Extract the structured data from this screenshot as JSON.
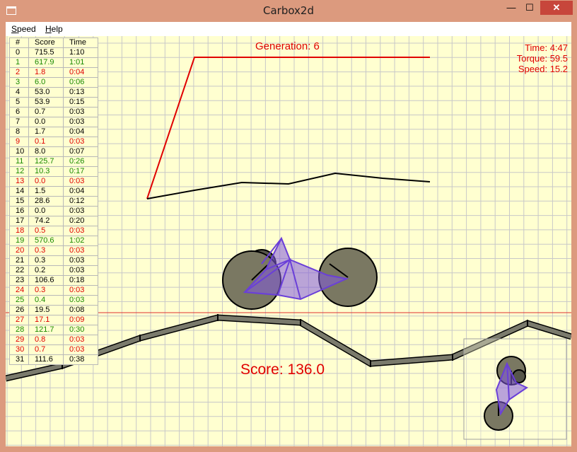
{
  "window": {
    "title": "Carbox2d",
    "minimize_glyph": "—",
    "maximize_glyph": "☐",
    "close_glyph": "✕"
  },
  "menu": {
    "speed": {
      "access": "S",
      "rest": "peed"
    },
    "help": {
      "access": "H",
      "rest": "elp"
    }
  },
  "table": {
    "headers": [
      "#",
      "Score",
      "Time"
    ],
    "rows": [
      {
        "n": "0",
        "score": "715.5",
        "time": "1:10",
        "status": "normal"
      },
      {
        "n": "1",
        "score": "617.9",
        "time": "1:01",
        "status": "best"
      },
      {
        "n": "2",
        "score": "1.8",
        "time": "0:04",
        "status": "worst"
      },
      {
        "n": "3",
        "score": "6.0",
        "time": "0:06",
        "status": "best"
      },
      {
        "n": "4",
        "score": "53.0",
        "time": "0:13",
        "status": "normal"
      },
      {
        "n": "5",
        "score": "53.9",
        "time": "0:15",
        "status": "normal"
      },
      {
        "n": "6",
        "score": "0.7",
        "time": "0:03",
        "status": "normal"
      },
      {
        "n": "7",
        "score": "0.0",
        "time": "0:03",
        "status": "normal"
      },
      {
        "n": "8",
        "score": "1.7",
        "time": "0:04",
        "status": "normal"
      },
      {
        "n": "9",
        "score": "0.1",
        "time": "0:03",
        "status": "worst"
      },
      {
        "n": "10",
        "score": "8.0",
        "time": "0:07",
        "status": "normal"
      },
      {
        "n": "11",
        "score": "125.7",
        "time": "0:26",
        "status": "best"
      },
      {
        "n": "12",
        "score": "10.3",
        "time": "0:17",
        "status": "best"
      },
      {
        "n": "13",
        "score": "0.0",
        "time": "0:03",
        "status": "worst"
      },
      {
        "n": "14",
        "score": "1.5",
        "time": "0:04",
        "status": "normal"
      },
      {
        "n": "15",
        "score": "28.6",
        "time": "0:12",
        "status": "normal"
      },
      {
        "n": "16",
        "score": "0.0",
        "time": "0:03",
        "status": "normal"
      },
      {
        "n": "17",
        "score": "74.2",
        "time": "0:20",
        "status": "normal"
      },
      {
        "n": "18",
        "score": "0.5",
        "time": "0:03",
        "status": "worst"
      },
      {
        "n": "19",
        "score": "570.6",
        "time": "1:02",
        "status": "best"
      },
      {
        "n": "20",
        "score": "0.3",
        "time": "0:03",
        "status": "worst"
      },
      {
        "n": "21",
        "score": "0.3",
        "time": "0:03",
        "status": "normal"
      },
      {
        "n": "22",
        "score": "0.2",
        "time": "0:03",
        "status": "normal"
      },
      {
        "n": "23",
        "score": "106.6",
        "time": "0:18",
        "status": "normal"
      },
      {
        "n": "24",
        "score": "0.3",
        "time": "0:03",
        "status": "worst"
      },
      {
        "n": "25",
        "score": "0.4",
        "time": "0:03",
        "status": "best"
      },
      {
        "n": "26",
        "score": "19.5",
        "time": "0:08",
        "status": "normal"
      },
      {
        "n": "27",
        "score": "17.1",
        "time": "0:09",
        "status": "worst"
      },
      {
        "n": "28",
        "score": "121.7",
        "time": "0:30",
        "status": "best"
      },
      {
        "n": "29",
        "score": "0.8",
        "time": "0:03",
        "status": "worst"
      },
      {
        "n": "30",
        "score": "0.7",
        "time": "0:03",
        "status": "worst"
      },
      {
        "n": "31",
        "score": "111.6",
        "time": "0:38",
        "status": "normal"
      }
    ]
  },
  "generation": {
    "text": "Generation: 6"
  },
  "stats": {
    "time": "Time: 4:47",
    "torque": "Torque: 59.5",
    "speed": "Speed: 15.2"
  },
  "score": {
    "text": "Score: 136.0"
  },
  "colors": {
    "background": "#ffffd0",
    "grid": "#c8c8c8",
    "text_red": "#e00000",
    "best_green": "#1a8a00",
    "car_body": "#7a52d0",
    "wheel": "#7a7862",
    "track_fill": "#7a7a6c"
  },
  "icons": [
    "app-icon",
    "minimize-icon",
    "maximize-icon",
    "close-icon"
  ]
}
